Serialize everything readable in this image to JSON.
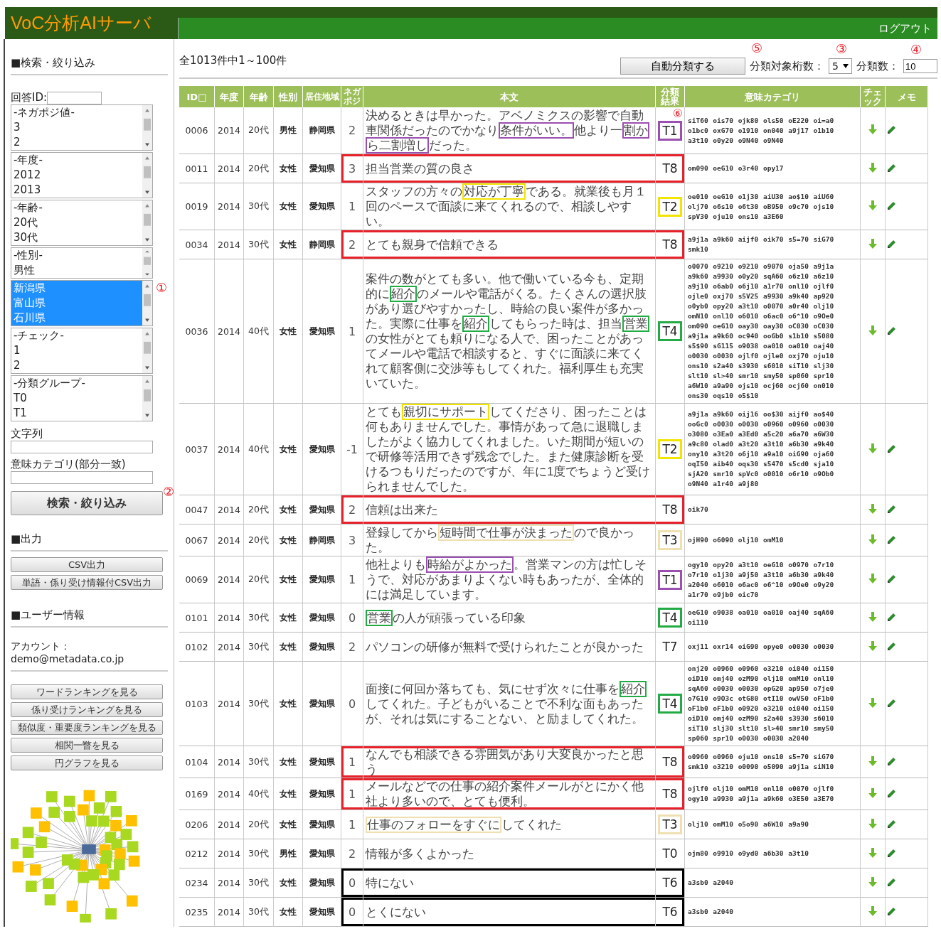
{
  "app": {
    "title": "VoC分析AIサーバ",
    "logout": "ログアウト"
  },
  "sidebar": {
    "search_heading": "■検索・絞り込み",
    "answer_id_label": "回答ID:",
    "listboxes": [
      {
        "items": [
          {
            "label": "-ネガポジ値-",
            "selected": false
          },
          {
            "label": "3",
            "selected": false
          },
          {
            "label": "2",
            "selected": false
          }
        ]
      },
      {
        "items": [
          {
            "label": "-年度-",
            "selected": false
          },
          {
            "label": "2012",
            "selected": false
          },
          {
            "label": "2013",
            "selected": false
          }
        ]
      },
      {
        "items": [
          {
            "label": "-年齢-",
            "selected": false
          },
          {
            "label": "20代",
            "selected": false
          },
          {
            "label": "30代",
            "selected": false
          }
        ]
      },
      {
        "items": [
          {
            "label": "-性別-",
            "selected": false
          },
          {
            "label": "男性",
            "selected": false
          }
        ]
      },
      {
        "callout": "①",
        "items": [
          {
            "label": "新潟県",
            "selected": true
          },
          {
            "label": "富山県",
            "selected": true
          },
          {
            "label": "石川県",
            "selected": true
          }
        ]
      },
      {
        "items": [
          {
            "label": "-チェック-",
            "selected": false
          },
          {
            "label": "1",
            "selected": false
          },
          {
            "label": "2",
            "selected": false
          }
        ]
      },
      {
        "items": [
          {
            "label": "-分類グループ-",
            "selected": false
          },
          {
            "label": "T0",
            "selected": false
          },
          {
            "label": "T1",
            "selected": false
          }
        ]
      }
    ],
    "text_filter_label": "文字列",
    "category_filter_label": "意味カテゴリ(部分一致)",
    "search_button": {
      "label": "検索・絞り込み",
      "callout": "②"
    },
    "output_heading": "■出力",
    "output_buttons": [
      "CSV出力",
      "単語・係り受け情報付CSV出力"
    ],
    "user_heading": "■ユーザー情報",
    "account_label": "アカウント：",
    "account": "demo@metadata.co.jp",
    "view_buttons": [
      "ワードランキングを見る",
      "係り受けランキングを見る",
      "類似度・重要度ランキングを見る",
      "相関一瞥を見る",
      "円グラフを見る"
    ]
  },
  "toolbar": {
    "count": "全1013件中1～100件",
    "auto_button": {
      "label": "自動分類する",
      "callout": "⑤"
    },
    "digits_label": "分類対象桁数：",
    "digits": {
      "value": "5",
      "callout": "③"
    },
    "clusters_label": "分類数：",
    "clusters": {
      "value": "10",
      "callout": "④"
    }
  },
  "table": {
    "columns": [
      "ID□",
      "年度",
      "年齢",
      "性別",
      "居住地域",
      "ネガポジ",
      "本文",
      "分類結果",
      "意味カテゴリ",
      "チェック",
      "メモ"
    ],
    "rows": [
      {
        "id": "0006",
        "year": "2014",
        "age": "20代",
        "gender": "男性",
        "region": "静岡県",
        "negaposi": "2",
        "body": [
          {
            "text": "決めるときは早かった。アベノミクスの影響で自動車関係だったのでかなり"
          },
          {
            "text": "条件がいい。",
            "color": "#9b4fb0"
          },
          {
            "text": "他より一"
          },
          {
            "text": "割から二割増し",
            "color": "#9b4fb0"
          },
          {
            "text": "だった。"
          }
        ],
        "result": {
          "text": "T1",
          "color": "#9b4fb0",
          "callout": "⑥"
        },
        "categories": "siT60 ois70 ojk80 ols50 oE220 oi=a0 o1bc0 oxG70 o1910 on040 a9j17 o1b10 a3t10 o0y20 o9N40 o9N40"
      },
      {
        "id": "0011",
        "year": "2014",
        "age": "20代",
        "gender": "女性",
        "region": "愛知県",
        "negaposi": "3",
        "body": [
          {
            "text": "担当営業の質の良さ"
          }
        ],
        "result": {
          "text": "T8"
        },
        "frame": {
          "color": "#e8202a"
        },
        "categories": "om090 oeG10 o3r40 opy17"
      },
      {
        "id": "0019",
        "year": "2014",
        "age": "30代",
        "gender": "女性",
        "region": "愛知県",
        "negaposi": "1",
        "body": [
          {
            "text": "スタッフの方々の"
          },
          {
            "text": "対応が丁寧",
            "color": "#f2e400"
          },
          {
            "text": "である。就業後も月１回のペースで面談に来てくれるので、相談しやすい。"
          }
        ],
        "result": {
          "text": "T2",
          "color": "#f2e400"
        },
        "categories": "oe010 oeG10 o1j30 aiU30 ao$10 aiU60 olj70 o6s10 o6t30 oB950 o9c70 ojs10 spV30 oju10 ons10 a3E60"
      },
      {
        "id": "0034",
        "year": "2014",
        "age": "30代",
        "gender": "女性",
        "region": "静岡県",
        "negaposi": "2",
        "body": [
          {
            "text": "とても親身で信頼できる"
          }
        ],
        "result": {
          "text": "T8"
        },
        "frame": {
          "color": "#e8202a"
        },
        "categories": "a9j1a a9k60 aijf0 oik70 s5=70 siG70 smk10"
      },
      {
        "id": "0036",
        "year": "2014",
        "age": "40代",
        "gender": "女性",
        "region": "愛知県",
        "negaposi": "1",
        "body": [
          {
            "text": "案件の数がとても多い。他で働いている今も、定期的に"
          },
          {
            "text": "紹介",
            "color": "#22aa44"
          },
          {
            "text": "のメールや電話がくる。たくさんの選択肢があり選びやすかったし、時給の良い案件が多かった。実際に仕事を"
          },
          {
            "text": "紹介",
            "color": "#22aa44"
          },
          {
            "text": "してもらった時は、担当"
          },
          {
            "text": "営業",
            "color": "#22aa44"
          },
          {
            "text": "の女性がとても頼りになる人で、困ったことがあってメールや電話で相談すると、すぐに面談に来てくれて顧客側に交渉等もしてくれた。福利厚生も充実いていた。"
          }
        ],
        "result": {
          "text": "T4",
          "color": "#22aa44"
        },
        "categories": "o0070 o9210 o9210 o9070 oja50 a9j1a a9k60 a9930 o0y20 sqA60 o6z10 a6z10 a9j10 o6ab0 o6j10 a1r70 onl10 ojlf0 ojle0 oxj70 s5V25 a9930 a9k40 ap920 o0yb0 opy20 a3t10 o0070 a0r40 olj10 omN10 onl10 o6010 o6ac0 o6^10 o9Oe0 om090 oeG10 oay30 oay30 oC030 oC030 a9j1a a9k60 oc940 ooGb0 s1b10 s5080 s5$90 sG115 o9038 oa010 oa010 oaj40 o0030 o0030 ojlf0 ojle0 oxj70 oju10 ons10 s2a40 s3930 s6010 siT10 slj30 slt10 sl>40 smr10 smy50 sp060 spr10 a6W10 a9a90 ojs10 ocj60 ocj60 on010 ons30 oqs10 o5$10"
      },
      {
        "id": "0037",
        "year": "2014",
        "age": "40代",
        "gender": "女性",
        "region": "愛知県",
        "negaposi": "-1",
        "body": [
          {
            "text": "とても"
          },
          {
            "text": "親切にサポート",
            "color": "#f2e400"
          },
          {
            "text": "してくださり、困ったことは何もありませんでした。事情があって急に退職しましたがよく協力してくれました。いた期間が短いので研修等活用できず残念でした。また健康診断を受けるつもりだったのですが、年に1度でちょうど受けられませんでした。"
          }
        ],
        "result": {
          "text": "T2",
          "color": "#f2e400"
        },
        "categories": "a9j1a a9k60 oij16 oo$30 aijf0 ao$40 ooGc0 o0030 o0030 o0960 o0960 o0030 o3080 o3Ea0 a3Ed0 a5c20 a6a70 a6W30 a9c80 olad0 a3t20 a3t10 a6b30 a9k40 ony10 a3t20 o6j10 a9a10 oiG90 oja60 oqI50 aib40 oqs30 s5470 s5cd0 sja10 sjA20 smr10 spVc0 o0010 o6r10 o9Ob0 o9N40 a1r40 a9j80"
      },
      {
        "id": "0047",
        "year": "2014",
        "age": "20代",
        "gender": "女性",
        "region": "愛知県",
        "negaposi": "2",
        "body": [
          {
            "text": "信頼は出来た"
          }
        ],
        "result": {
          "text": "T8"
        },
        "frame": {
          "color": "#e8202a"
        },
        "categories": "oik70"
      },
      {
        "id": "0067",
        "year": "2014",
        "age": "20代",
        "gender": "女性",
        "region": "静岡県",
        "negaposi": "3",
        "body": [
          {
            "text": "登録してから"
          },
          {
            "text": "短時間で仕事が決まった",
            "color": "#eee0b0"
          },
          {
            "text": "ので良かった。"
          }
        ],
        "result": {
          "text": "T3",
          "color": "#eee0b0"
        },
        "categories": "ojH90 o6090 olj10 omM10"
      },
      {
        "id": "0069",
        "year": "2014",
        "age": "20代",
        "gender": "女性",
        "region": "愛知県",
        "negaposi": "1",
        "body": [
          {
            "text": "他社よりも"
          },
          {
            "text": "時給がよかった",
            "color": "#9b4fb0"
          },
          {
            "text": "。営業マンの方は忙しそうで、対応があまりよくない時もあったが、全体的には満足しています。"
          }
        ],
        "result": {
          "text": "T1",
          "color": "#9b4fb0"
        },
        "categories": "ogy10 opy20 a3t10 oeG10 o0970 o7r10 o7r10 o1j30 a9j50 a3t10 a6b30 a9k40 a2040 o6010 o6ac0 o6^10 o9Oe0 o9y20 a1r70 o9jb0 oic70"
      },
      {
        "id": "0101",
        "year": "2014",
        "age": "30代",
        "gender": "女性",
        "region": "愛知県",
        "negaposi": "0",
        "body": [
          {
            "text": "営業",
            "color": "#22aa44"
          },
          {
            "text": "の人が頑張っている印象"
          }
        ],
        "result": {
          "text": "T4",
          "color": "#22aa44"
        },
        "categories": "oeG10 o9038 oa010 oa010 oaj40 sqA60 oi110"
      },
      {
        "id": "0102",
        "year": "2014",
        "age": "30代",
        "gender": "女性",
        "region": "愛知県",
        "negaposi": "2",
        "body": [
          {
            "text": "パソコンの研修が無料で受けられたことが良かった"
          }
        ],
        "result": {
          "text": "T7"
        },
        "categories": "oxj11 oxr14 oiG90 opye0 o0030 o0030"
      },
      {
        "id": "0103",
        "year": "2014",
        "age": "30代",
        "gender": "女性",
        "region": "愛知県",
        "negaposi": "0",
        "body": [
          {
            "text": "面接に何回か落ちても、気にせず次々に仕事を"
          },
          {
            "text": "紹介",
            "color": "#22aa44"
          },
          {
            "text": "してくれた。子どもがいることで不利な面もあったが、それは気にすることない、と励ましてくれた。"
          }
        ],
        "result": {
          "text": "T4",
          "color": "#22aa44"
        },
        "categories": "onj20 o0960 o0960 o3210 oi040 oi150 oiD10 omj40 ozM90 olj10 omM10 onl10 sqA60 o0030 o0030 opG20 ap950 o7je0 o7G10 o9O3c otG80 otI10 owV50 oF1b0 oF1b0 oF1b0 o0920 o3210 oi040 oi150 oiD10 omj40 ozM90 s2a40 s3930 s6010 siT10 slj30 slt10 sl>40 smr10 smy50 sp060 spr10 o0030 o0030 a2040"
      },
      {
        "id": "0104",
        "year": "2014",
        "age": "30代",
        "gender": "女性",
        "region": "愛知県",
        "negaposi": "1",
        "body": [
          {
            "text": "なんでも相談できる雰囲気があり大変良かったと思う"
          }
        ],
        "result": {
          "text": "T8"
        },
        "frame": {
          "color": "#e8202a"
        },
        "categories": "o0960 o0960 oju10 ons10 s5=70 siG70 smk10 o3210 o0090 o5090 a9j1a siN10"
      },
      {
        "id": "0169",
        "year": "2014",
        "age": "40代",
        "gender": "女性",
        "region": "愛知県",
        "negaposi": "1",
        "body": [
          {
            "text": "メールなどでの仕事の紹介案件メールがとにかく他社より多いので、とても便利。"
          }
        ],
        "result": {
          "text": "T8"
        },
        "frame": {
          "color": "#e8202a"
        },
        "categories": "ojlf0 olj10 omM10 onl10 o0070 ojlf0 ogy10 a9930 a9j1a a9k60 o3E50 a3E70"
      },
      {
        "id": "0206",
        "year": "2014",
        "age": "20代",
        "gender": "女性",
        "region": "愛知県",
        "negaposi": "1",
        "body": [
          {
            "text": "仕事のフォローをすぐに",
            "color": "#eee0b0"
          },
          {
            "text": "してくれた"
          }
        ],
        "result": {
          "text": "T3",
          "color": "#eee0b0"
        },
        "categories": "olj10 omM10 o5o90 a6W10 a9a90"
      },
      {
        "id": "0212",
        "year": "2014",
        "age": "30代",
        "gender": "男性",
        "region": "愛知県",
        "negaposi": "2",
        "body": [
          {
            "text": "情報が多くよかった"
          }
        ],
        "result": {
          "text": "T0"
        },
        "categories": "ojm80 o9910 o9yd0 a6b30 a3t10"
      },
      {
        "id": "0234",
        "year": "2014",
        "age": "30代",
        "gender": "女性",
        "region": "愛知県",
        "negaposi": "0",
        "body": [
          {
            "text": "特にない"
          }
        ],
        "result": {
          "text": "T6"
        },
        "frame": {
          "color": "#000000"
        },
        "categories": "a3sb0 a2040"
      },
      {
        "id": "0235",
        "year": "2014",
        "age": "30代",
        "gender": "女性",
        "region": "愛知県",
        "negaposi": "0",
        "body": [
          {
            "text": "とくにない"
          }
        ],
        "result": {
          "text": "T6"
        },
        "frame": {
          "color": "#000000"
        },
        "categories": "a3sb0 a2040"
      }
    ]
  }
}
